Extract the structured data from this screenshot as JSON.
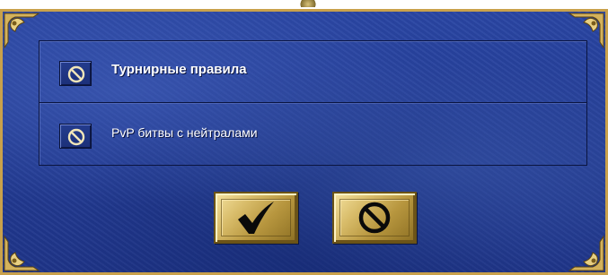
{
  "options": [
    {
      "label": "Турнирные правила",
      "icon": "forbidden-icon",
      "bold": true
    },
    {
      "label": "PvP битвы с нейтралами",
      "icon": "forbidden-icon",
      "bold": false
    }
  ],
  "buttons": {
    "ok_icon": "checkmark-icon",
    "cancel_icon": "forbidden-icon"
  },
  "colors": {
    "background": "#233c95",
    "border": "#c9a14b",
    "gold": "#d9bd6b",
    "text": "#ffffff"
  }
}
